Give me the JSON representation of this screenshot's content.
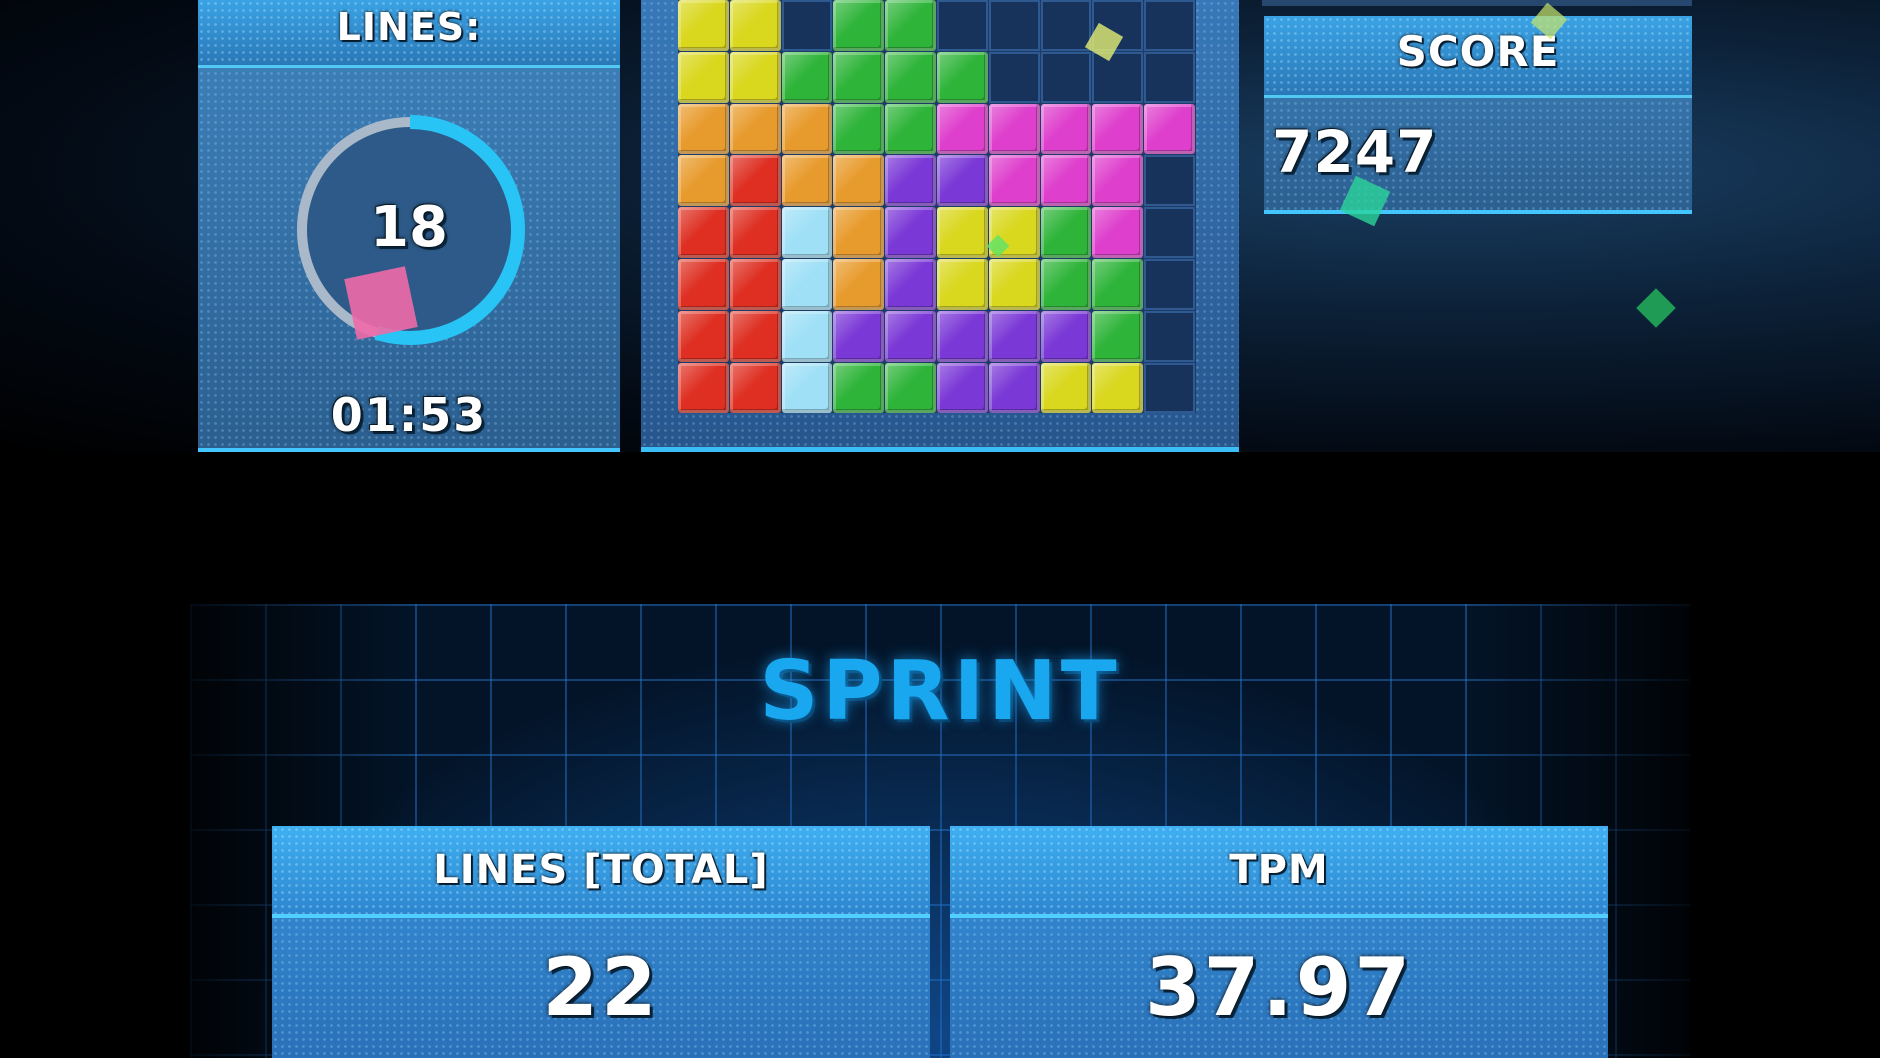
{
  "lines_panel": {
    "label": "LINES:",
    "lines_remaining": "18",
    "timer": "01:53",
    "progress_fraction": 0.55
  },
  "score_panel": {
    "label": "SCORE",
    "value": "7247"
  },
  "playfield": {
    "columns": 10,
    "visible_rows": 8,
    "colors": {
      "Y": "#d9d71e",
      "G": "#2fb43a",
      "O": "#e89b2d",
      "P": "#de3fcc",
      "R": "#de2f22",
      "C": "#9fe0f7",
      "V": "#7a38d6"
    },
    "rows": [
      "YY.GG.....",
      "YYGGGG....",
      "OOOGGPPPPP",
      "OROOVVPPP.",
      "RRCOVYYGP.",
      "RRCOVYYGG.",
      "RRCVVVVVG.",
      "RRCGGVVYY."
    ]
  },
  "results": {
    "mode_title": "SPRINT",
    "lines_total_label": "LINES [TOTAL]",
    "lines_total_value": "22",
    "tpm_label": "TPM",
    "tpm_value": "37.97"
  }
}
